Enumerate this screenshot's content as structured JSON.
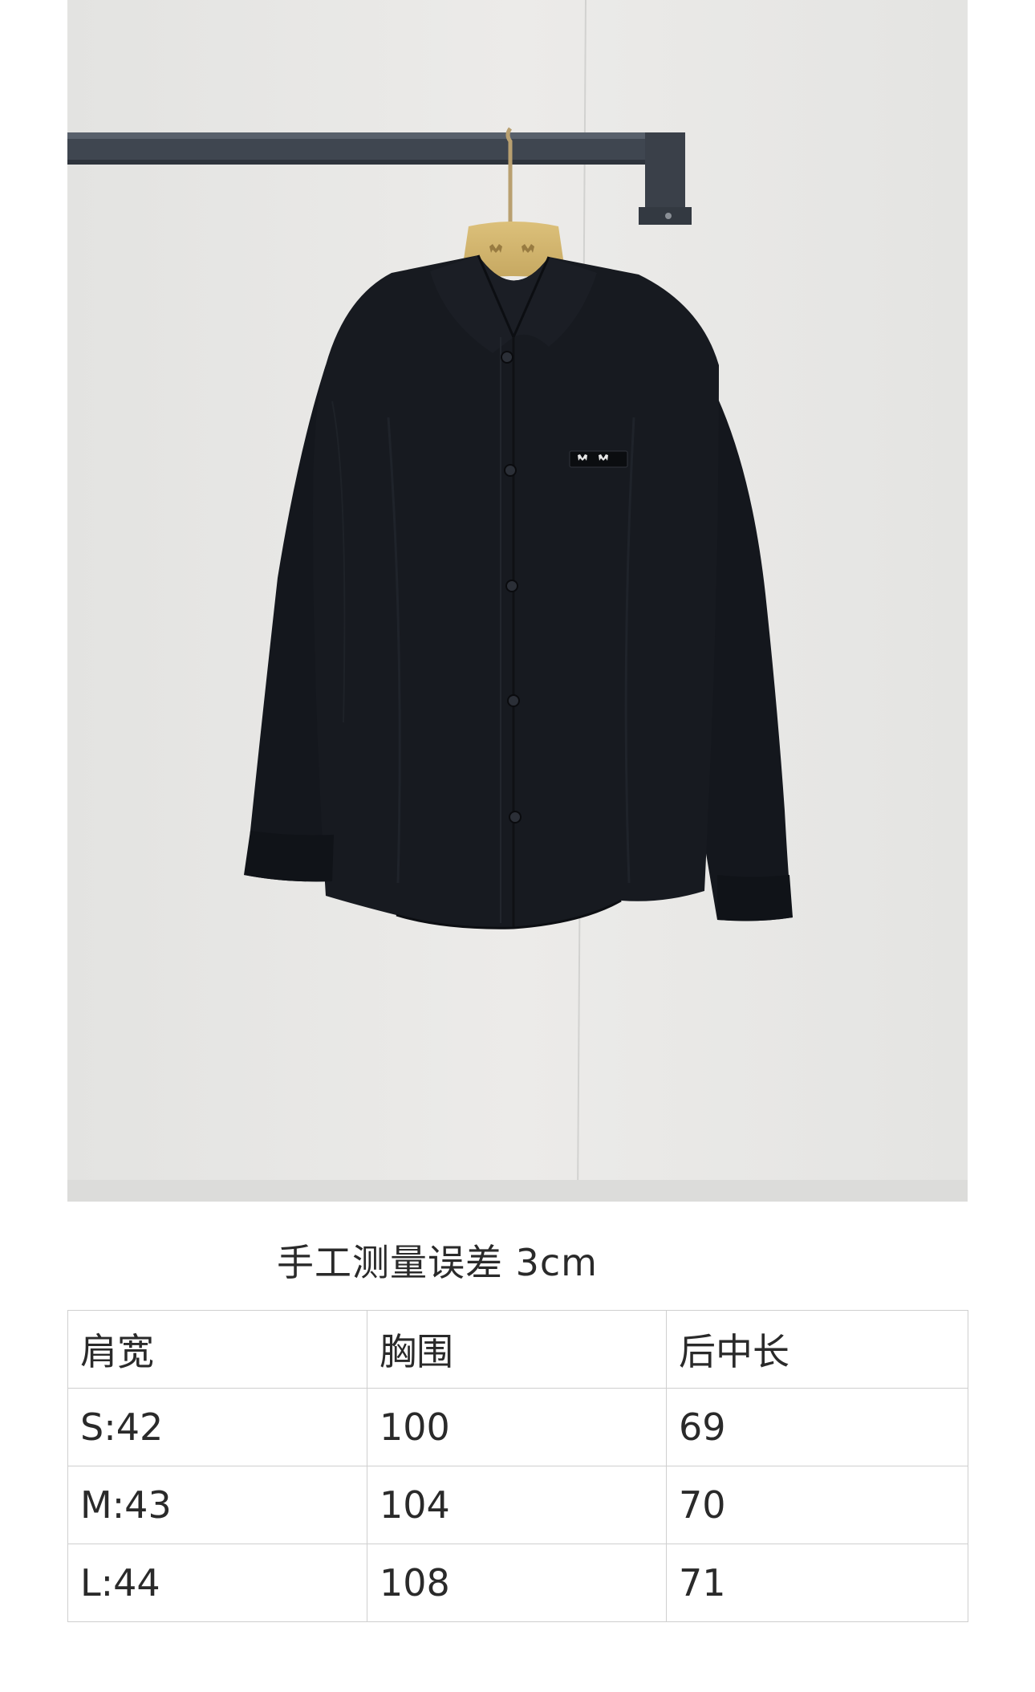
{
  "photo": {
    "hanger_logo": "miu miu",
    "chest_label": "miu miu",
    "colors": {
      "wall": "#e9e9e7",
      "rail": "#3f4650",
      "hanger": "#d2b56e",
      "shirt": "#15181e"
    }
  },
  "caption": "手工测量误差 3cm",
  "size_table": {
    "headers": [
      "肩宽",
      "胸围",
      "后中长"
    ],
    "rows": [
      [
        "S:42",
        "100",
        "69"
      ],
      [
        "M:43",
        "104",
        "70"
      ],
      [
        "L:44",
        "108",
        "71"
      ]
    ]
  }
}
